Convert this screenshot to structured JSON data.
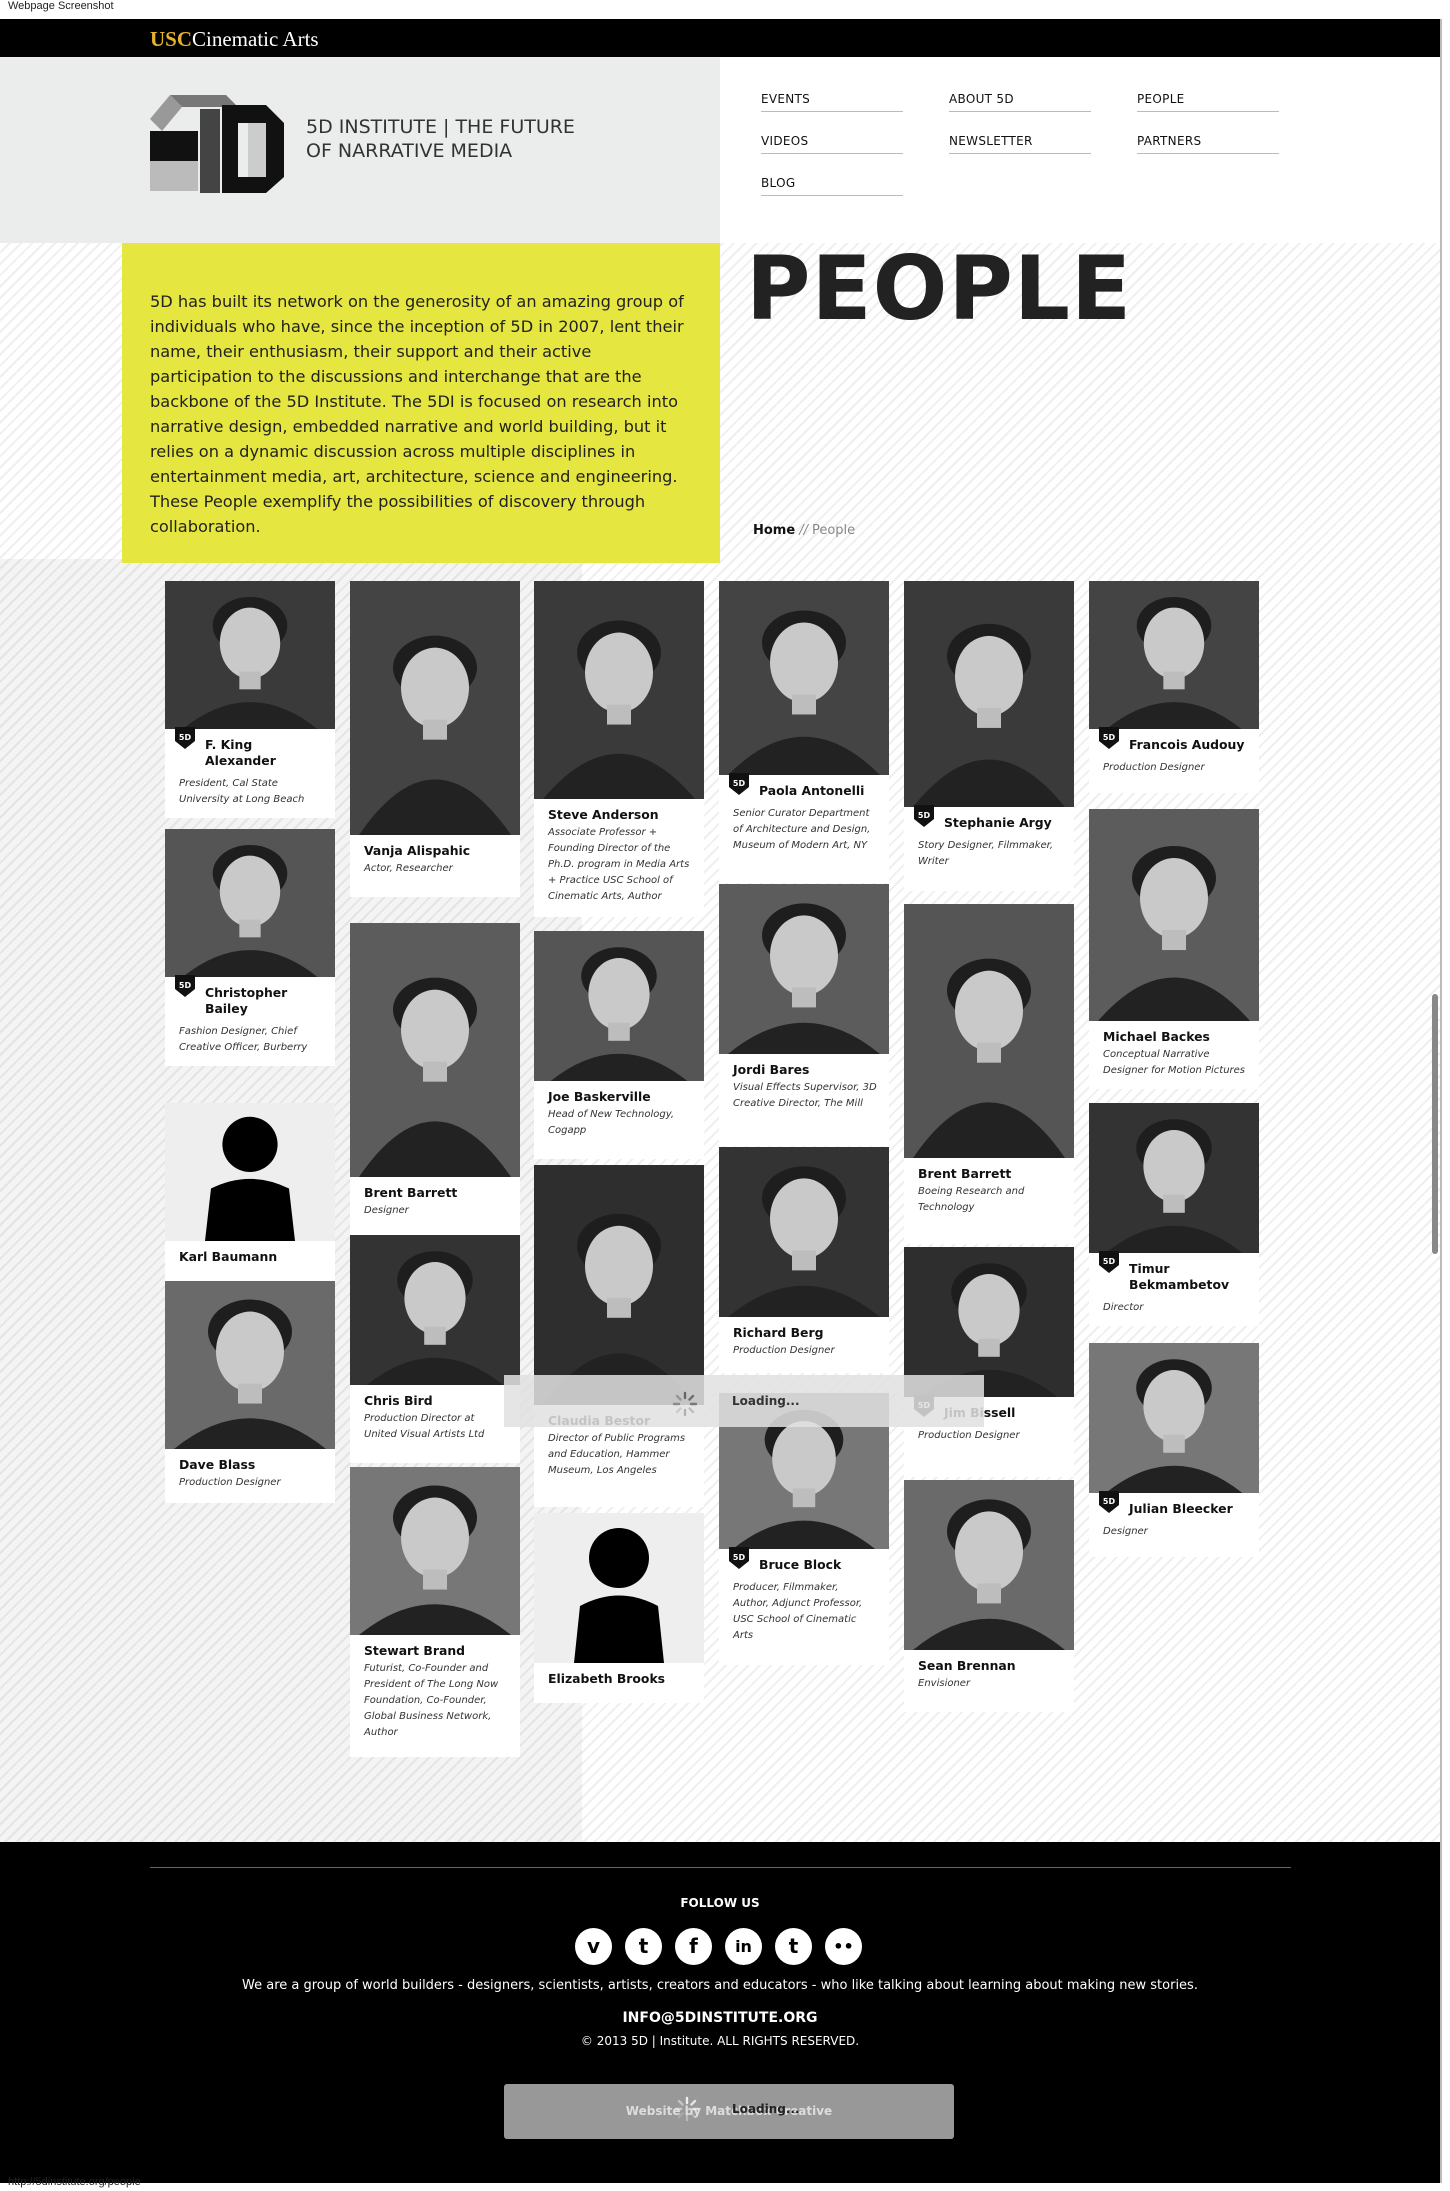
{
  "window_caption": "Webpage Screenshot",
  "status_url": "http://5dinstitute.org/people",
  "topbar": {
    "usc": "USC",
    "cinematic_arts": "Cinematic Arts"
  },
  "brand": {
    "institute_name": "5D INSTITUTE | THE FUTURE\nOF NARRATIVE MEDIA"
  },
  "nav": [
    {
      "label": "EVENTS"
    },
    {
      "label": "ABOUT 5D"
    },
    {
      "label": "PEOPLE"
    },
    {
      "label": "VIDEOS"
    },
    {
      "label": "NEWSLETTER"
    },
    {
      "label": "PARTNERS"
    },
    {
      "label": "BLOG"
    }
  ],
  "page_title": "PEOPLE",
  "intro": "5D has built its network on the generosity of an amazing group of individuals who have, since the inception of 5D in 2007, lent their name, their enthusiasm, their support and their active participation to the discussions and interchange that are the backbone of the 5D Institute. The 5DI is focused on research into narrative design, embedded narrative and world building, but it relies on a dynamic discussion across multiple disciplines in entertainment media, art, architecture, science and engineering. These People exemplify the possibilities of discovery through collaboration.",
  "breadcrumb": {
    "home": "Home",
    "separator": "//",
    "current": "People"
  },
  "people": [
    {
      "name": "F. King Alexander",
      "role": "President, Cal State University at Long Beach",
      "badge": true
    },
    {
      "name": "Christopher Bailey",
      "role": "Fashion Designer, Chief Creative Officer, Burberry",
      "badge": true
    },
    {
      "name": "Karl Baumann",
      "role": "",
      "badge": false,
      "placeholder": true
    },
    {
      "name": "Dave Blass",
      "role": "Production Designer",
      "badge": false
    },
    {
      "name": "Vanja Alispahic",
      "role": "Actor, Researcher",
      "badge": false
    },
    {
      "name": "Brent Barrett",
      "role": "Designer",
      "badge": false
    },
    {
      "name": "Chris Bird",
      "role": "Production Director at United Visual Artists Ltd",
      "badge": false
    },
    {
      "name": "Stewart Brand",
      "role": "Futurist, Co-Founder and President of The Long Now Foundation, Co-Founder, Global Business Network, Author",
      "badge": false
    },
    {
      "name": "Steve Anderson",
      "role": "Associate Professor + Founding Director of the Ph.D. program in Media Arts + Practice USC School of Cinematic Arts, Author",
      "badge": false
    },
    {
      "name": "Joe Baskerville",
      "role": "Head of New Technology, Cogapp",
      "badge": false
    },
    {
      "name": "Claudia Bestor",
      "role": "Director of Public Programs and Education, Hammer Museum, Los Angeles",
      "badge": false
    },
    {
      "name": "Elizabeth Brooks",
      "role": "",
      "badge": false,
      "placeholder": true
    },
    {
      "name": "Paola Antonelli",
      "role": "Senior Curator Department of Architecture and Design, Museum of Modern Art, NY",
      "badge": true
    },
    {
      "name": "Jordi Bares",
      "role": "Visual Effects Supervisor, 3D Creative Director, The Mill",
      "badge": false
    },
    {
      "name": "Richard Berg",
      "role": "Production Designer",
      "badge": false
    },
    {
      "name": "Bruce Block",
      "role": "Producer, Filmmaker, Author, Adjunct Professor, USC School of Cinematic Arts",
      "badge": true
    },
    {
      "name": "Stephanie Argy",
      "role": "Story Designer, Filmmaker, Writer",
      "badge": true
    },
    {
      "name": "Brent Barrett",
      "role": "Boeing Research and Technology",
      "badge": false
    },
    {
      "name": "Jim Bissell",
      "role": "Production Designer",
      "badge": true
    },
    {
      "name": "Sean Brennan",
      "role": "Envisioner",
      "badge": false
    },
    {
      "name": "Francois Audouy",
      "role": "Production Designer",
      "badge": true
    },
    {
      "name": "Michael Backes",
      "role": "Conceptual Narrative Designer for Motion Pictures",
      "badge": false
    },
    {
      "name": "Timur Bekmambetov",
      "role": "Director",
      "badge": true
    },
    {
      "name": "Julian Bleecker",
      "role": "Designer",
      "badge": true
    }
  ],
  "loading_text": "Loading...",
  "footer": {
    "follow": "FOLLOW US",
    "socials": [
      {
        "icon": "vimeo-icon",
        "glyph": "v"
      },
      {
        "icon": "twitter-icon",
        "glyph": "t"
      },
      {
        "icon": "facebook-icon",
        "glyph": "f"
      },
      {
        "icon": "linkedin-icon",
        "glyph": "in"
      },
      {
        "icon": "tumblr-icon",
        "glyph": "t"
      },
      {
        "icon": "flickr-icon",
        "glyph": "••"
      }
    ],
    "tagline": "We are a group of world builders - designers, scientists, artists, creators and educators - who like talking about learning about making new stories.",
    "email": "INFO@5DINSTITUTE.ORG",
    "copyright": "© 2013 5D | Institute. ALL RIGHTS RESERVED.",
    "credit": "Website by Matchbox Creative"
  },
  "colors": {
    "accent_yellow": "#e6e640",
    "usc_gold": "#e3b32c",
    "black": "#000000",
    "panel_grey": "#ebedec"
  }
}
